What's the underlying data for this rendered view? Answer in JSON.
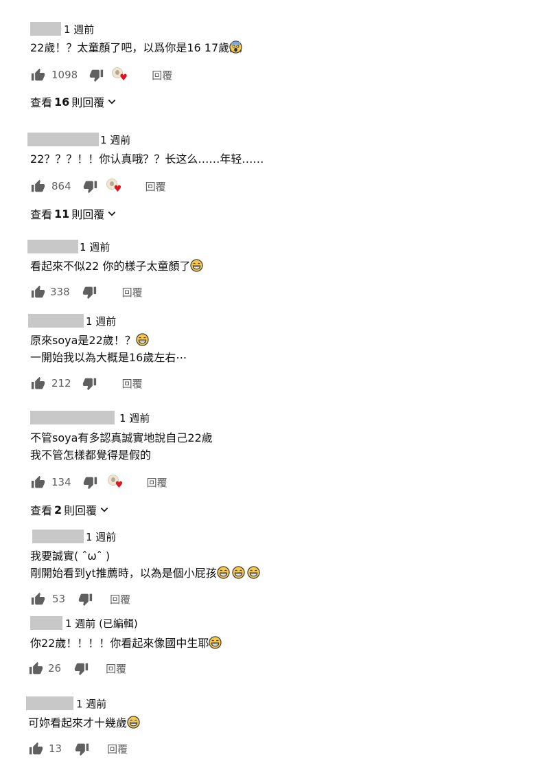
{
  "labels": {
    "reply": "回覆",
    "view_prefix": "查看",
    "view_suffix": "則回覆"
  },
  "comments": [
    {
      "time": "1 週前",
      "lines": [
        "22歲！？太童顏了吧，以爲你是16 17歲"
      ],
      "likes": "1098",
      "view_count": "16"
    },
    {
      "time": "1 週前",
      "lines": [
        "22？？？！！你认真哦？？长这么……年轻……"
      ],
      "likes": "864",
      "view_count": "11"
    },
    {
      "time": "1 週前",
      "lines": [
        "看起來不似22 你的樣子太童顏了"
      ],
      "likes": "338"
    },
    {
      "time": "1 週前",
      "lines": [
        "原來soya是22歲！？",
        "一開始我以為大概是16歲左右⋯"
      ],
      "likes": "212"
    },
    {
      "time": "1 週前",
      "lines": [
        "不管soya有多認真誠實地說自己22歲",
        "我不管怎樣都覺得是假的"
      ],
      "likes": "134",
      "view_count": "2"
    },
    {
      "time": "1 週前",
      "lines": [
        "我要誠實( ˆωˆ )",
        "剛開始看到yt推薦時，以為是個小屁孩"
      ],
      "likes": "53"
    },
    {
      "time": "1 週前 (已編輯)",
      "lines": [
        "你22歲！！！！你看起來像國中生耶"
      ],
      "likes": "26"
    },
    {
      "time": "1 週前",
      "lines": [
        "可妳看起來才十幾歲"
      ],
      "likes": "13"
    }
  ],
  "icons": {
    "like": "thumb-up-icon",
    "dislike": "thumb-down-icon",
    "creator_heart": "creator-heart-icon",
    "emoji_laugh": "grinning-sweat-emoji",
    "emoji_scream": "screaming-face-emoji",
    "chevron": "chevron-down-icon"
  },
  "colors": {
    "heart": "#e0141e",
    "secondary_text": "#606060",
    "redaction": "#c8c8c8"
  }
}
